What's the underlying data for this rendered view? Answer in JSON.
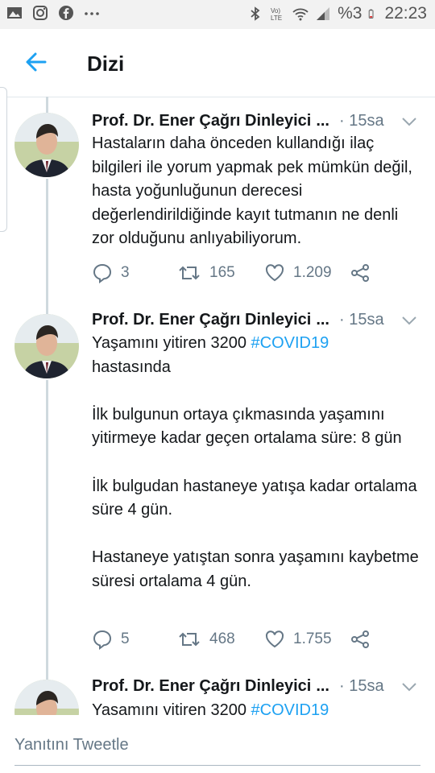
{
  "status_bar": {
    "battery_percent": "%3",
    "clock": "22:23",
    "left_icons": [
      "gallery-icon",
      "instagram-icon",
      "facebook-icon",
      "more-icon"
    ],
    "right_icons": [
      "bluetooth-icon",
      "volte-icon",
      "wifi-icon",
      "signal-icon",
      "battery-icon"
    ]
  },
  "header": {
    "title": "Dizi"
  },
  "tweets": [
    {
      "author": "Prof. Dr. Ener Çağrı Dinleyici",
      "ellipsis": "...",
      "time": "· 15sa",
      "paragraphs": [
        "Hastaların daha önceden kullandığı ilaç bilgileri ile yorum yapmak pek mümkün değil, hasta yoğunluğunun derecesi değerlendirildiğinde kayıt tutmanın ne denli zor olduğunu anlıyabiliyorum."
      ],
      "replies": "3",
      "retweets": "165",
      "likes": "1.209"
    },
    {
      "author": "Prof. Dr. Ener Çağrı Dinleyici",
      "ellipsis": "...",
      "time": "· 15sa",
      "line1_prefix": "Yaşamını yitiren 3200 ",
      "hashtag": "#COVID19",
      "line1_suffix": "hastasında",
      "paragraphs": [
        "İlk bulgunun ortaya çıkmasında yaşamını yitirmeye kadar geçen ortalama süre: 8 gün",
        "İlk bulgudan hastaneye yatışa kadar ortalama süre 4 gün.",
        "Hastaneye yatıştan sonra yaşamını kaybetme süresi ortalama 4 gün."
      ],
      "replies": "5",
      "retweets": "468",
      "likes": "1.755"
    },
    {
      "author": "Prof. Dr. Ener Çağrı Dinleyici",
      "ellipsis": "...",
      "time": "· 15sa",
      "line1_prefix": "Yaşamını yitiren 3200 ",
      "hashtag": "#COVID19"
    }
  ],
  "reply_bar": {
    "placeholder": "Yanıtını Tweetle"
  },
  "colors": {
    "accent": "#1da1f2",
    "text": "#14171a",
    "muted": "#657786",
    "thread_line": "#cfd9de"
  }
}
